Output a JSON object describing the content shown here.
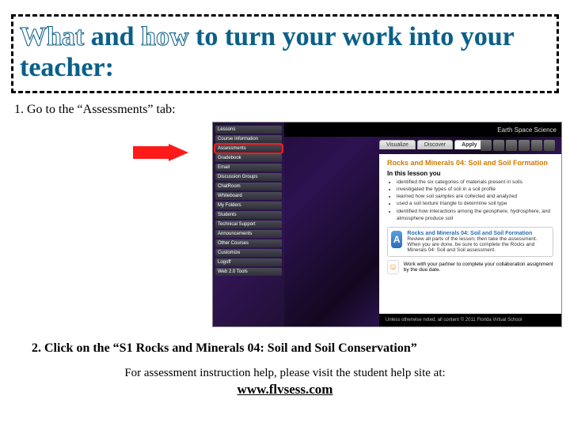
{
  "title": {
    "segment1_outline": "What",
    "segment2_solid": " and ",
    "segment3_outline": "how",
    "segment4_solid": " to turn your work into your teacher:"
  },
  "step1": "1. Go to the “Assessments” tab:",
  "step2": "2.  Click on the “S1 Rocks and Minerals 04: Soil and Soil Conservation”",
  "help_line": "For assessment instruction help, please visit the student help site at:",
  "help_link": "www.flvsess.com",
  "lms": {
    "topbar_right": "Earth Space Science",
    "sidebar": {
      "items": [
        "Lessons",
        "Course Information",
        "Assessments",
        "Gradebook",
        "Email",
        "Discussion Groups",
        "ChatRoom",
        "Whiteboard",
        "My Folders",
        "Students",
        "Technical Support",
        "Announcements",
        "Other Courses",
        "Customize",
        "Logoff",
        "Web 2.0 Tools"
      ],
      "highlight_index": 2
    },
    "tabs": {
      "items": [
        "Visualize",
        "Discover",
        "Apply"
      ],
      "active": 2
    },
    "lesson_title": "Rocks and Minerals 04: Soil and Soil Formation",
    "section_head": "In this lesson you",
    "bullets": [
      "identified the six categories of materials present in soils",
      "investigated the types of soil in a soil profile",
      "learned how soil samples are collected and analyzed",
      "used a soil texture triangle to determine soil type",
      "identified how interactions among the geosphere, hydrosphere, and atmosphere produce soil"
    ],
    "card": {
      "badge": "A",
      "title": "Rocks and Minerals 04: Soil and Soil Formation",
      "line1": "Review all parts of the lesson; then take the assessment.",
      "line2": "When you are done, be sure to complete the Rocks and Minerals 04: Soil and Soil assessment."
    },
    "partner": "Work with your partner to complete your collaboration assignment by the due date.",
    "footer": "Unless otherwise noted, all content © 2011 Florida Virtual School"
  }
}
